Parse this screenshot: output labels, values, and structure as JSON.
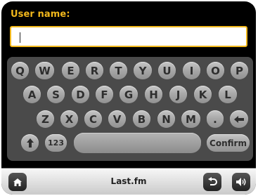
{
  "form": {
    "user_name_label": "User name:",
    "user_name_value": ""
  },
  "keyboard": {
    "rows": [
      [
        "Q",
        "W",
        "E",
        "R",
        "T",
        "Y",
        "U",
        "I",
        "O",
        "P"
      ],
      [
        "A",
        "S",
        "D",
        "F",
        "G",
        "H",
        "J",
        "K",
        "L"
      ],
      [
        "Z",
        "X",
        "C",
        "V",
        "B",
        "N",
        "M",
        "."
      ]
    ],
    "numbers_label": "123",
    "confirm_label": "Confirm",
    "backspace_icon": "arrow-left-icon",
    "shift_icon": "arrow-up-icon"
  },
  "bottom_bar": {
    "title": "Last.fm",
    "home_icon": "home-icon",
    "back_icon": "undo-icon",
    "volume_icon": "volume-icon"
  },
  "colors": {
    "accent": "#f2b81c",
    "background": "#000000",
    "key": "#a9a9a9"
  }
}
